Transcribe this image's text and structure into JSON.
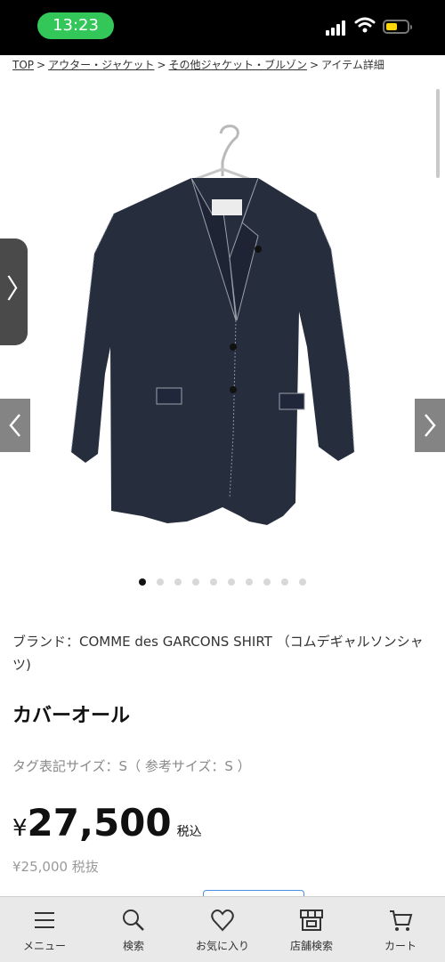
{
  "status_bar": {
    "time": "13:23"
  },
  "breadcrumb": {
    "items": [
      "TOP",
      "アウター・ジャケット",
      "その他ジャケット・ブルゾン",
      "アイテム詳細"
    ],
    "separator": ">"
  },
  "gallery": {
    "side_tab_glyph": "〉",
    "image_count": 10,
    "active_index": 0
  },
  "product": {
    "brand": "ブランド：COMME des GARCONS SHIRT （コムデギャルソンシャツ)",
    "title": "カバーオール",
    "size": "タグ表記サイズ：S（ 参考サイズ：S ）",
    "price_symbol": "¥",
    "price": "27,500",
    "price_tax_label": "税込",
    "price_ex_tax": "¥25,000 税抜"
  },
  "bottom_nav": {
    "items": [
      {
        "label": "メニュー",
        "icon": "menu-icon"
      },
      {
        "label": "検索",
        "icon": "search-icon"
      },
      {
        "label": "お気に入り",
        "icon": "heart-icon"
      },
      {
        "label": "店舗検索",
        "icon": "store-icon"
      },
      {
        "label": "カート",
        "icon": "cart-icon"
      }
    ]
  },
  "colors": {
    "status_pill": "#33c759",
    "jacket": "#262d3d",
    "nav_bg": "#e9e9e9"
  }
}
